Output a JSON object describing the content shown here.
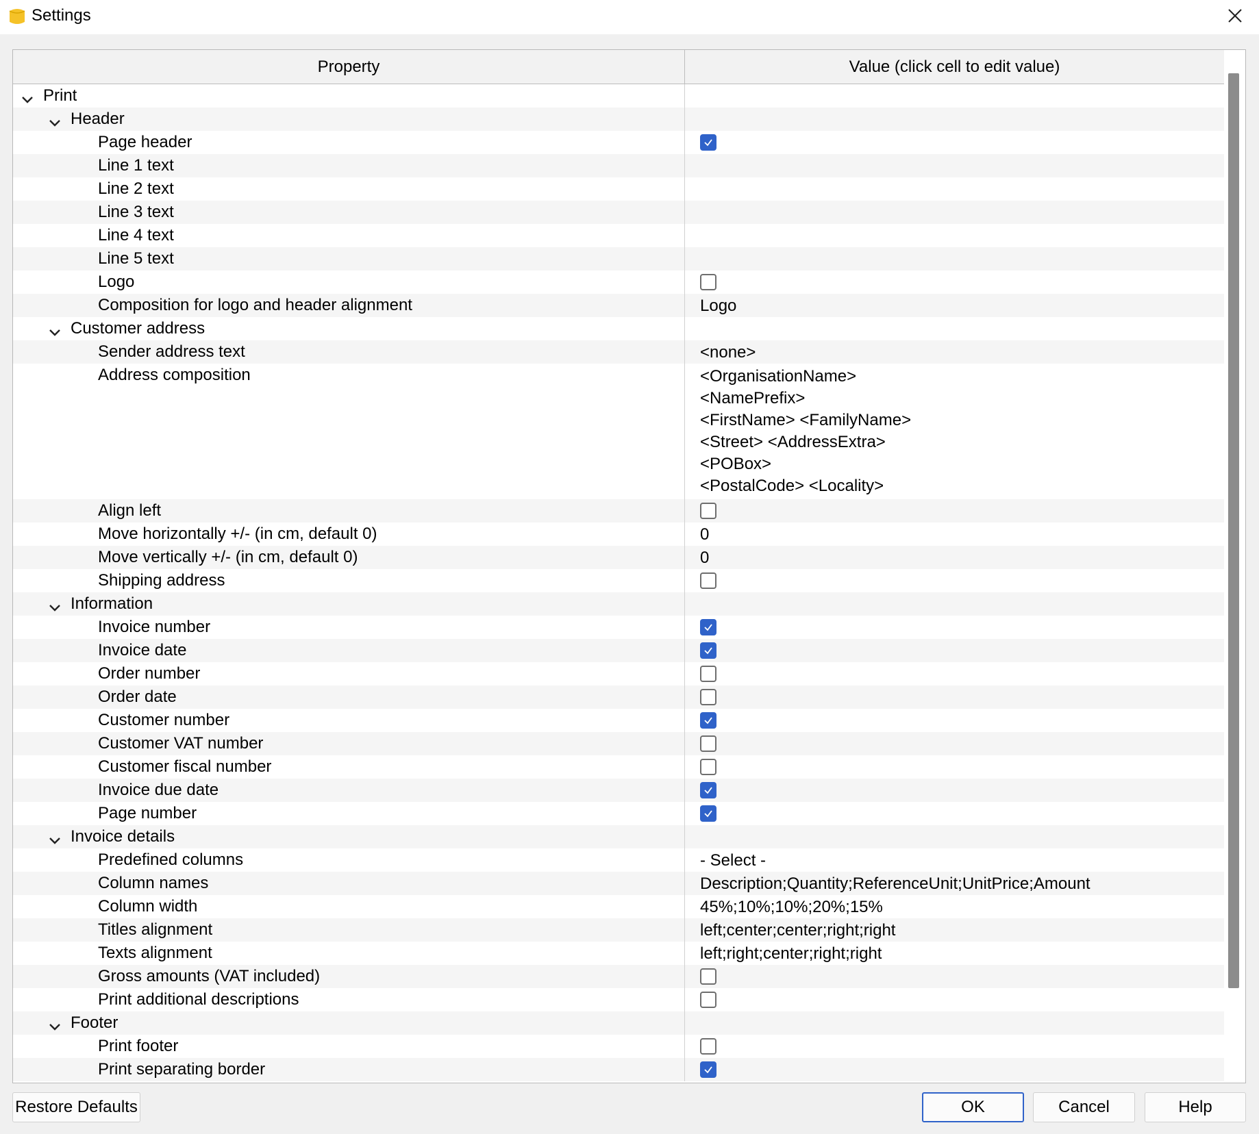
{
  "window": {
    "title": "Settings"
  },
  "columns": {
    "property": "Property",
    "value": "Value (click cell to edit value)"
  },
  "rows": [
    {
      "level": 0,
      "label": "Print",
      "group": true
    },
    {
      "level": 1,
      "label": "Header",
      "group": true
    },
    {
      "level": 2,
      "label": "Page header",
      "checkbox": true
    },
    {
      "level": 2,
      "label": "Line 1 text",
      "value": ""
    },
    {
      "level": 2,
      "label": "Line 2 text",
      "value": ""
    },
    {
      "level": 2,
      "label": "Line 3 text",
      "value": ""
    },
    {
      "level": 2,
      "label": "Line 4 text",
      "value": ""
    },
    {
      "level": 2,
      "label": "Line 5 text",
      "value": ""
    },
    {
      "level": 2,
      "label": "Logo",
      "checkbox": false
    },
    {
      "level": 2,
      "label": "Composition for logo and header alignment",
      "value": "Logo"
    },
    {
      "level": 1,
      "label": "Customer address",
      "group": true
    },
    {
      "level": 2,
      "label": "Sender address text",
      "value": "<none>"
    },
    {
      "level": 2,
      "label": "Address composition",
      "lines": [
        "<OrganisationName>",
        "<NamePrefix>",
        "<FirstName>  <FamilyName>",
        "<Street>  <AddressExtra>",
        "<POBox>",
        "<PostalCode>  <Locality>"
      ]
    },
    {
      "level": 2,
      "label": "Align left",
      "checkbox": false
    },
    {
      "level": 2,
      "label": "Move horizontally +/- (in cm, default 0)",
      "value": "0"
    },
    {
      "level": 2,
      "label": "Move vertically +/- (in cm, default 0)",
      "value": "0"
    },
    {
      "level": 2,
      "label": "Shipping address",
      "checkbox": false
    },
    {
      "level": 1,
      "label": "Information",
      "group": true
    },
    {
      "level": 2,
      "label": "Invoice number",
      "checkbox": true
    },
    {
      "level": 2,
      "label": "Invoice date",
      "checkbox": true
    },
    {
      "level": 2,
      "label": "Order number",
      "checkbox": false
    },
    {
      "level": 2,
      "label": "Order date",
      "checkbox": false
    },
    {
      "level": 2,
      "label": "Customer number",
      "checkbox": true
    },
    {
      "level": 2,
      "label": "Customer VAT number",
      "checkbox": false
    },
    {
      "level": 2,
      "label": "Customer fiscal number",
      "checkbox": false
    },
    {
      "level": 2,
      "label": "Invoice due date",
      "checkbox": true
    },
    {
      "level": 2,
      "label": "Page number",
      "checkbox": true
    },
    {
      "level": 1,
      "label": "Invoice details",
      "group": true
    },
    {
      "level": 2,
      "label": "Predefined columns",
      "value": "- Select -"
    },
    {
      "level": 2,
      "label": "Column names",
      "value": "Description;Quantity;ReferenceUnit;UnitPrice;Amount"
    },
    {
      "level": 2,
      "label": "Column width",
      "value": "45%;10%;10%;20%;15%"
    },
    {
      "level": 2,
      "label": "Titles alignment",
      "value": "left;center;center;right;right"
    },
    {
      "level": 2,
      "label": "Texts alignment",
      "value": "left;right;center;right;right"
    },
    {
      "level": 2,
      "label": "Gross amounts (VAT included)",
      "checkbox": false
    },
    {
      "level": 2,
      "label": "Print additional descriptions",
      "checkbox": false
    },
    {
      "level": 1,
      "label": "Footer",
      "group": true
    },
    {
      "level": 2,
      "label": "Print footer",
      "checkbox": false
    },
    {
      "level": 2,
      "label": "Print separating border",
      "checkbox": true
    }
  ],
  "buttons": {
    "restore": "Restore Defaults",
    "ok": "OK",
    "cancel": "Cancel",
    "help": "Help"
  },
  "colors": {
    "accent": "#2f62c9",
    "app_icon": "#f5c228"
  },
  "icons": {
    "app": "app-icon",
    "close": "close-icon",
    "expand": "chevron-down-icon",
    "check": "check-icon"
  }
}
